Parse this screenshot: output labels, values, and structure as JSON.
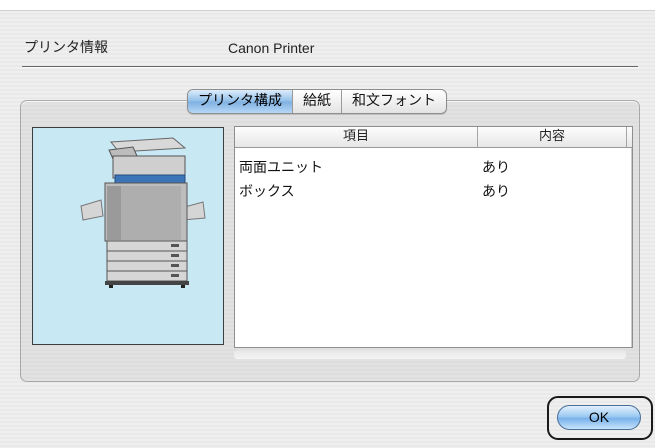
{
  "header": {
    "printer_info_label": "プリンタ情報",
    "printer_name": "Canon Printer"
  },
  "tabs": [
    {
      "label": "プリンタ構成",
      "active": true
    },
    {
      "label": "給紙",
      "active": false
    },
    {
      "label": "和文フォント",
      "active": false
    }
  ],
  "table": {
    "columns": [
      "項目",
      "内容"
    ],
    "rows": [
      {
        "item": "両面ユニット",
        "value": "あり"
      },
      {
        "item": "ボックス",
        "value": "あり"
      }
    ]
  },
  "footer": {
    "ok_label": "OK"
  },
  "colors": {
    "accent_blue": "#7eb0e1",
    "printer_panel_bg": "#c8e8f4"
  },
  "icons": {
    "printer": "printer-illustration"
  }
}
